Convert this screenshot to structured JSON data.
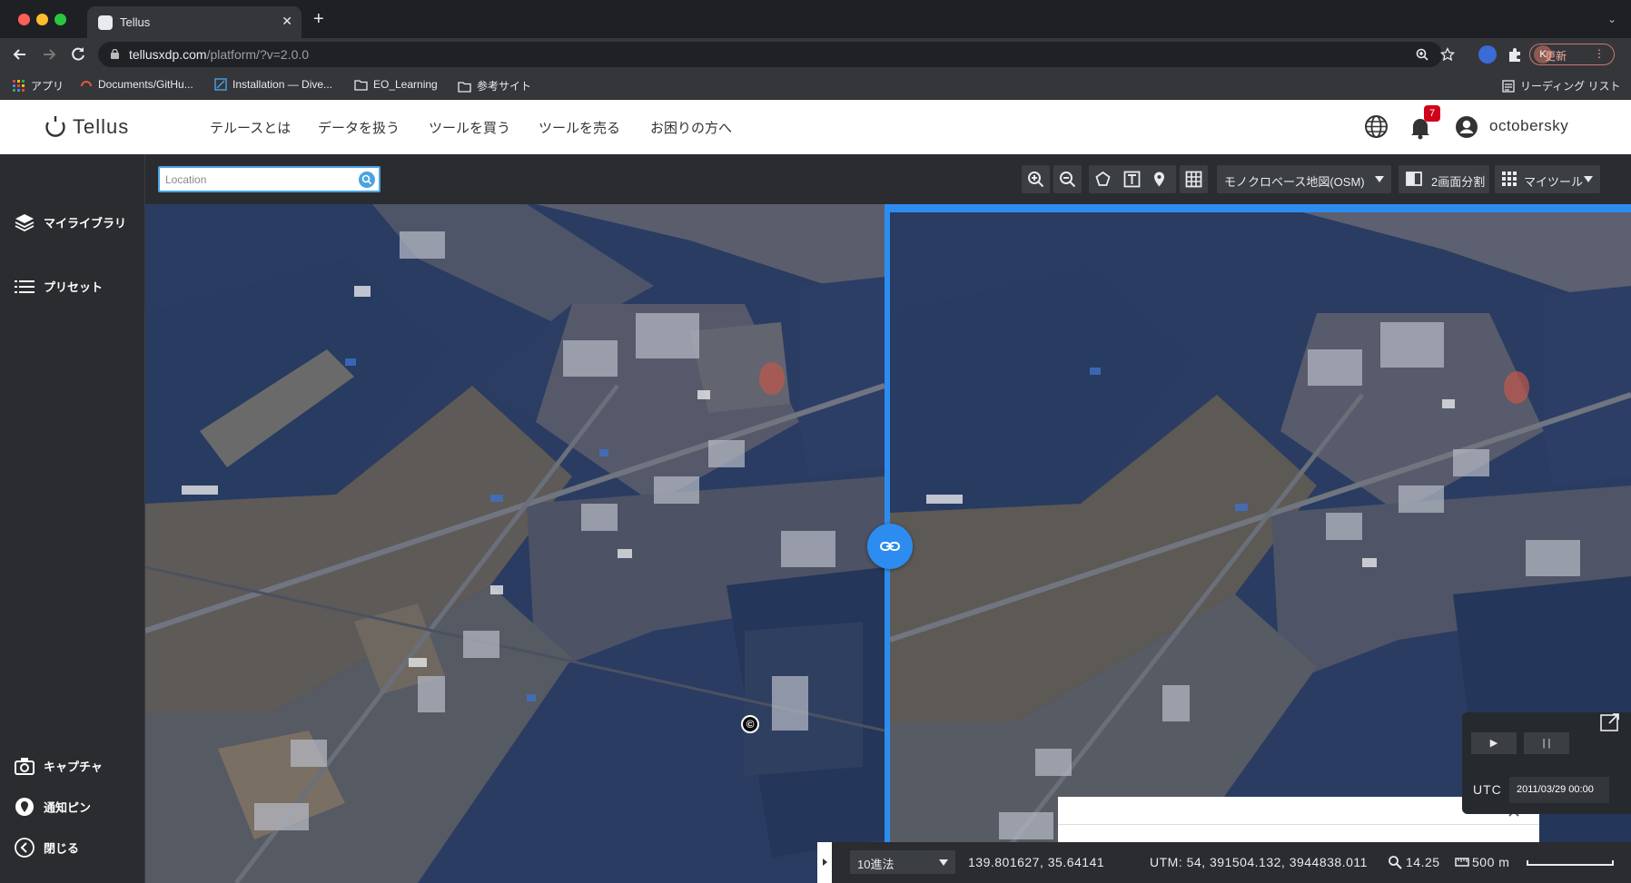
{
  "browser": {
    "tab_title": "Tellus",
    "url_host": "tellusxdp.com",
    "url_path": "/platform/?v=2.0.0",
    "profile_initial": "K",
    "update_label": "更新",
    "bookmarks": [
      {
        "label": "アプリ",
        "icon": "apps-grid-icon"
      },
      {
        "label": "Documents/GitHu...",
        "icon": "site-favicon"
      },
      {
        "label": "Installation — Dive...",
        "icon": "site-favicon"
      },
      {
        "label": "EO_Learning",
        "icon": "folder-icon"
      },
      {
        "label": "参考サイト",
        "icon": "folder-icon"
      }
    ],
    "reading_list_label": "リーディング リスト"
  },
  "header": {
    "logo_text": "Tellus",
    "nav": [
      "テルースとは",
      "データを扱う",
      "ツールを買う",
      "ツールを売る",
      "お困りの方へ"
    ],
    "notification_count": "7",
    "username": "octobersky"
  },
  "sidebar": {
    "top_items": [
      {
        "label": "マイライブラリ",
        "icon": "layers-icon"
      },
      {
        "label": "プリセット",
        "icon": "list-icon"
      }
    ],
    "bottom_items": [
      {
        "label": "キャプチャ",
        "icon": "camera-icon"
      },
      {
        "label": "通知ピン",
        "icon": "pin-icon"
      },
      {
        "label": "閉じる",
        "icon": "back-circle-icon"
      }
    ]
  },
  "map_toolbar": {
    "search_placeholder": "Location",
    "basemap": "モノクロベース地図(OSM)",
    "split_label": "2画面分割",
    "mytool_label": "マイツール"
  },
  "time_panel": {
    "play_label": "▶",
    "pause_label": "| |",
    "tz": "UTC",
    "datetime": "2011/03/29 00:00"
  },
  "status": {
    "coord_format": "10進法",
    "latlon": "139.801627, 35.64141",
    "utm": "UTM: 54, 391504.132, 3944838.011",
    "zoom": "14.25",
    "scale": "500 m"
  },
  "colors": {
    "accent": "#2d8cf0",
    "sidebar_bg": "#2a2c2f",
    "badge": "#d0021b"
  }
}
